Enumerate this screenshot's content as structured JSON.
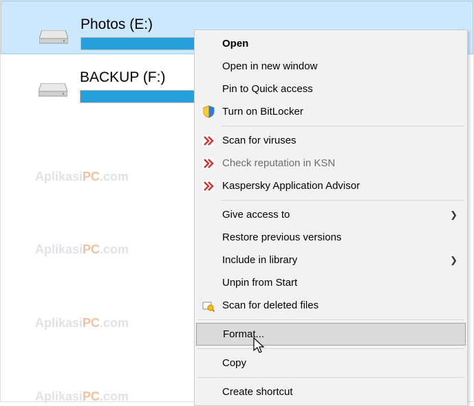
{
  "watermark": {
    "part1": "Aplikasi",
    "part2": "PC",
    "suffix": ".com"
  },
  "drives": [
    {
      "label": "Photos (E:)",
      "fill_percent": 100,
      "selected": true
    },
    {
      "label": "BACKUP (F:)",
      "fill_percent": 100,
      "selected": false
    }
  ],
  "context_menu": {
    "groups": [
      [
        {
          "label": "Open",
          "bold": true
        },
        {
          "label": "Open in new window"
        },
        {
          "label": "Pin to Quick access"
        },
        {
          "label": "Turn on BitLocker",
          "icon": "shield-icon"
        }
      ],
      [
        {
          "label": "Scan for viruses",
          "icon": "kaspersky-icon"
        },
        {
          "label": "Check reputation in KSN",
          "icon": "kaspersky-icon",
          "disabled": true
        },
        {
          "label": "Kaspersky Application Advisor",
          "icon": "kaspersky-icon"
        }
      ],
      [
        {
          "label": "Give access to",
          "submenu": true
        },
        {
          "label": "Restore previous versions"
        },
        {
          "label": "Include in library",
          "submenu": true
        },
        {
          "label": "Unpin from Start"
        },
        {
          "label": "Scan for deleted files",
          "icon": "search-icon"
        }
      ],
      [
        {
          "label": "Format...",
          "hovered": true
        }
      ],
      [
        {
          "label": "Copy"
        }
      ],
      [
        {
          "label": "Create shortcut"
        }
      ]
    ]
  }
}
